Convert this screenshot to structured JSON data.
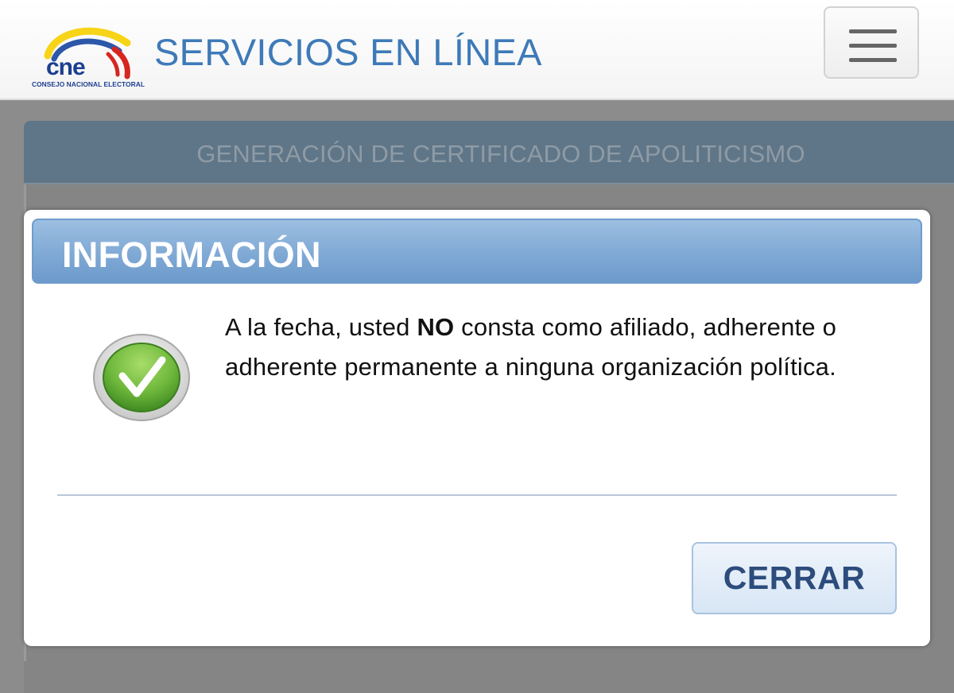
{
  "header": {
    "logo_text": "CONSEJO NACIONAL ELECTORAL",
    "logo_mark": "cne",
    "title": "SERVICIOS EN LÍNEA",
    "menu_icon": "hamburger-menu-icon"
  },
  "page": {
    "section_title": "GENERACIÓN DE CERTIFICADO DE APOLITICISMO"
  },
  "dialog": {
    "title": "INFORMACIÓN",
    "icon": "check-icon",
    "message_part1": "A la fecha, usted ",
    "message_bold": "NO",
    "message_part2": " consta como afiliado, adherente o adherente permanente a ninguna organización política.",
    "close_label": "CERRAR"
  },
  "colors": {
    "title_blue": "#3e7ab8",
    "dialog_header_blue": "#82abd6",
    "check_green": "#6fb83c",
    "overlay_gray": "#8c8c8c"
  }
}
